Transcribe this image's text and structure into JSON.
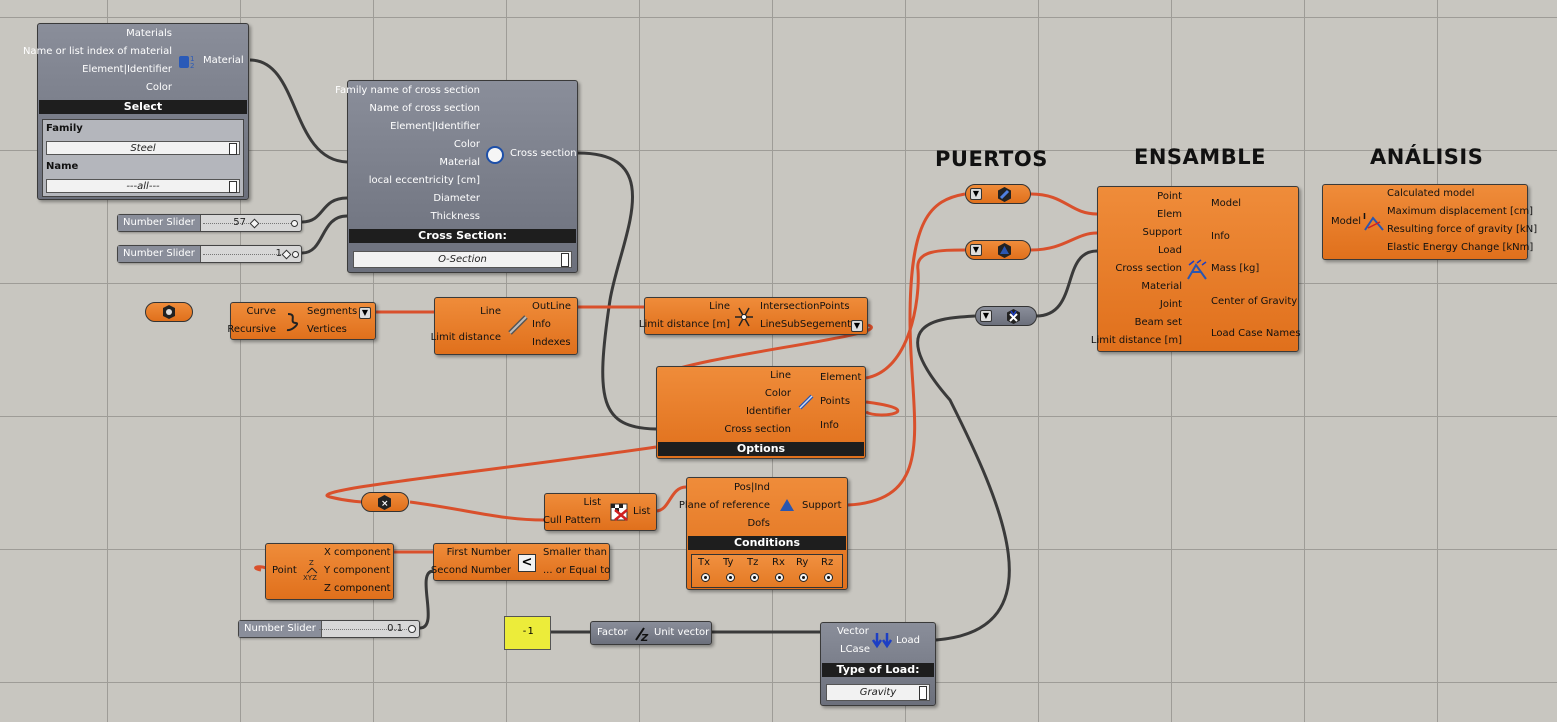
{
  "headings": {
    "puertos": "PUERTOS",
    "ensamble": "ENSAMBLE",
    "analisis": "ANÁLISIS"
  },
  "material_node": {
    "inputs": [
      "Materials",
      "Name or list index of material",
      "Element|Identifier",
      "Color"
    ],
    "output": "Material",
    "bar": "Select",
    "family_label": "Family",
    "family_value": "Steel",
    "name_label": "Name",
    "name_value": "---all---"
  },
  "cross_section_node": {
    "inputs": [
      "Family name of cross section",
      "Name of cross section",
      "Element|Identifier",
      "Color",
      "Material",
      "local eccentricity [cm]",
      "Diameter",
      "Thickness"
    ],
    "output": "Cross section",
    "bar": "Cross Section:",
    "value": "O-Section"
  },
  "sliders": [
    {
      "name": "Number Slider",
      "value": "57"
    },
    {
      "name": "Number Slider",
      "value": "1"
    },
    {
      "name": "Number Slider",
      "value": "0.1"
    }
  ],
  "explode_node": {
    "inputs": [
      "Curve",
      "Recursive"
    ],
    "outputs": [
      "Segments",
      "Vertices"
    ]
  },
  "line_to_beam_node": {
    "inputs": [
      "Line",
      "Limit distance"
    ],
    "outputs": [
      "OutLine",
      "Info",
      "Indexes"
    ]
  },
  "line_line_node": {
    "inputs": [
      "Line",
      "Limit distance [m]"
    ],
    "outputs": [
      "IntersectionPoints",
      "LineSubSegements"
    ]
  },
  "beam_node": {
    "inputs": [
      "Line",
      "Color",
      "Identifier",
      "Cross section"
    ],
    "outputs": [
      "Element",
      "Points",
      "Info"
    ],
    "bar": "Options"
  },
  "cull_node": {
    "inputs": [
      "List",
      "Cull Pattern"
    ],
    "output": "List"
  },
  "deconstruct_node": {
    "input": "Point",
    "outputs": [
      "X component",
      "Y component",
      "Z component"
    ]
  },
  "smaller_node": {
    "inputs": [
      "First Number",
      "Second Number"
    ],
    "outputs": [
      "Smaller than",
      "... or Equal to"
    ]
  },
  "support_node": {
    "inputs": [
      "Pos|Ind",
      "Plane of reference",
      "Dofs"
    ],
    "output": "Support",
    "bar": "Conditions",
    "dofs": [
      "Tx",
      "Ty",
      "Tz",
      "Rx",
      "Ry",
      "Rz"
    ]
  },
  "panel": {
    "value": "-1"
  },
  "unit_z_node": {
    "input": "Factor",
    "output": "Unit vector"
  },
  "load_node": {
    "inputs": [
      "Vector",
      "LCase"
    ],
    "output": "Load",
    "bar": "Type of Load:",
    "value": "Gravity"
  },
  "assemble_node": {
    "inputs": [
      "Point",
      "Elem",
      "Support",
      "Load",
      "Cross section",
      "Material",
      "Joint",
      "Beam set",
      "Limit distance [m]"
    ],
    "outputs": [
      "Model",
      "Info",
      "Mass [kg]",
      "Center of Gravity",
      "Load Case Names"
    ]
  },
  "analysis_node": {
    "input": "Model",
    "outputs": [
      "Calculated model",
      "Maximum displacement [cm]",
      "Resulting force of gravity [kN]",
      "Elastic Energy Change [kNm]"
    ]
  },
  "colors": {
    "wire_active": "#d9502c",
    "wire_default": "#3a3a3a",
    "node_orange": "#e8801f",
    "node_gray": "#7a7e8a",
    "panel_yellow": "#ecec3a"
  }
}
